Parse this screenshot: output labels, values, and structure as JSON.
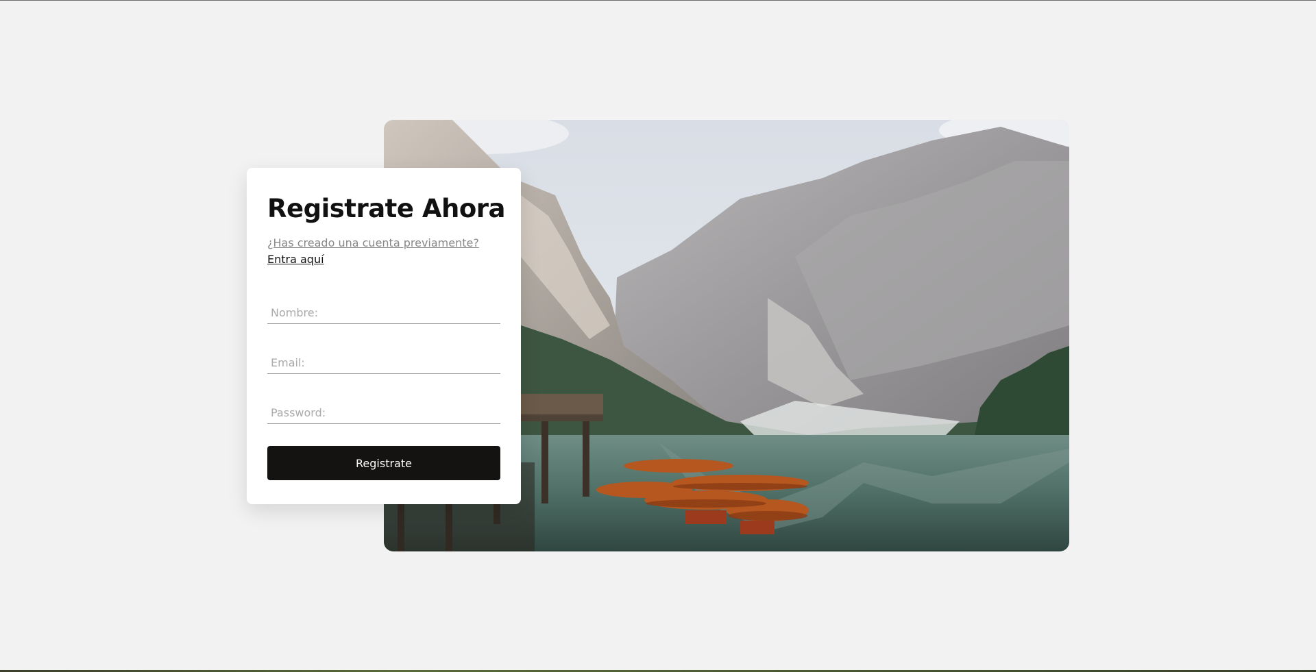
{
  "form": {
    "title": "Registrate Ahora",
    "login_prompt": "¿Has creado una cuenta previamente?",
    "login_link": "Entra aquí",
    "name_placeholder": "Nombre:",
    "email_placeholder": "Email:",
    "password_placeholder": "Password:",
    "submit_label": "Registrate"
  },
  "colors": {
    "background": "#f2f2f2",
    "card": "#ffffff",
    "button": "#151311",
    "button_text": "#ffffff",
    "title": "#111111",
    "muted_link": "#888888"
  }
}
